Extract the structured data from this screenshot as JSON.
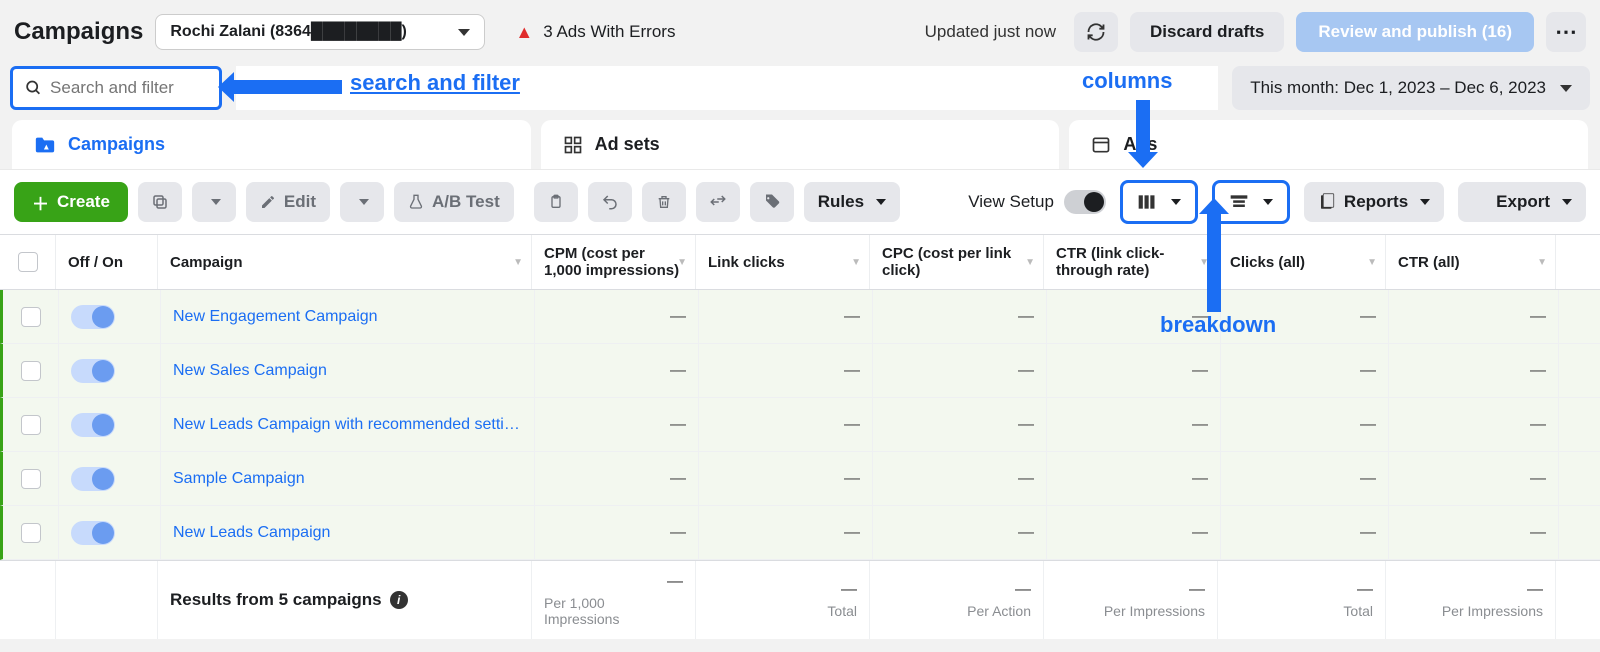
{
  "header": {
    "title": "Campaigns",
    "account": "Rochi Zalani (8364████████)",
    "errors": "3 Ads With Errors",
    "updated": "Updated just now",
    "discard": "Discard drafts",
    "review": "Review and publish (16)"
  },
  "search": {
    "placeholder": "Search and filter"
  },
  "daterange": "This month: Dec 1, 2023 – Dec 6, 2023",
  "annotations": {
    "search": "search and filter",
    "columns": "columns",
    "breakdown": "breakdown"
  },
  "tabs": {
    "campaigns": "Campaigns",
    "adsets": "Ad sets",
    "ads": "Ads"
  },
  "toolbar": {
    "create": "Create",
    "edit": "Edit",
    "abtest": "A/B Test",
    "rules": "Rules",
    "viewsetup": "View Setup",
    "reports": "Reports",
    "export": "Export"
  },
  "columns": {
    "offon": "Off / On",
    "campaign": "Campaign",
    "cpm": "CPM (cost per 1,000 impressions)",
    "linkclicks": "Link clicks",
    "cpc": "CPC (cost per link click)",
    "ctr": "CTR (link click-through rate)",
    "clicksall": "Clicks (all)",
    "ctrall": "CTR (all)"
  },
  "rows": [
    {
      "name": "New Engagement Campaign",
      "cpm": "—",
      "link": "—",
      "cpc": "—",
      "ctr": "—",
      "clicks": "—",
      "ctrall": "—"
    },
    {
      "name": "New Sales Campaign",
      "cpm": "—",
      "link": "—",
      "cpc": "—",
      "ctr": "—",
      "clicks": "—",
      "ctrall": "—"
    },
    {
      "name": "New Leads Campaign with recommended setti…",
      "cpm": "—",
      "link": "—",
      "cpc": "—",
      "ctr": "—",
      "clicks": "—",
      "ctrall": "—"
    },
    {
      "name": "Sample Campaign",
      "cpm": "—",
      "link": "—",
      "cpc": "—",
      "ctr": "—",
      "clicks": "—",
      "ctrall": "—"
    },
    {
      "name": "New Leads Campaign",
      "cpm": "—",
      "link": "—",
      "cpc": "—",
      "ctr": "—",
      "clicks": "—",
      "ctrall": "—"
    }
  ],
  "footer": {
    "label": "Results from 5 campaigns",
    "cpm_sub": "Per 1,000 Impressions",
    "link_sub": "Total",
    "cpc_sub": "Per Action",
    "ctr_sub": "Per Impressions",
    "clicks_sub": "Total",
    "ctrall_sub": "Per Impressions",
    "dash": "—"
  }
}
